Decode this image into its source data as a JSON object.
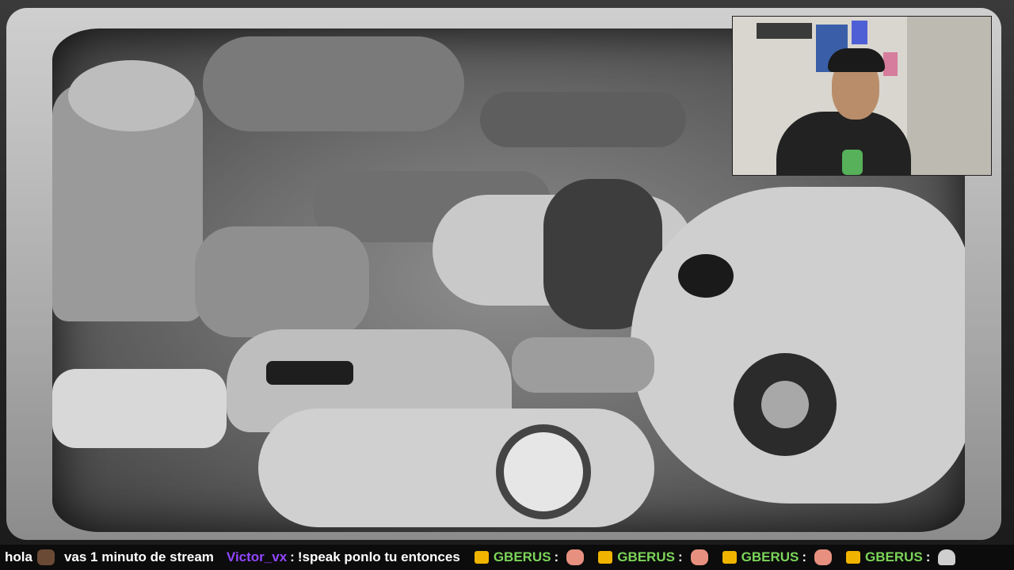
{
  "chat": {
    "messages": [
      {
        "text": "hola",
        "emote": "brown-bear-emote"
      },
      {
        "text": "vas 1 minuto de stream"
      },
      {
        "user": "Victor_vx",
        "sep": ":",
        "text": "!speak ponlo tu entonces"
      },
      {
        "user": "GBERUS",
        "sep": ":",
        "badge": "crown-badge-icon",
        "emote": "pink-foot-emote"
      },
      {
        "user": "GBERUS",
        "sep": ":",
        "badge": "crown-badge-icon",
        "emote": "pink-foot-emote"
      },
      {
        "user": "GBERUS",
        "sep": ":",
        "badge": "crown-badge-icon",
        "emote": "pink-foot-emote"
      },
      {
        "user": "GBERUS",
        "sep": ":",
        "badge": "crown-badge-icon",
        "emote": "ghost-emote"
      }
    ],
    "colors": {
      "purple": "#9147ff",
      "green": "#7cd45a",
      "badge": "#f0b400"
    }
  },
  "video": {
    "description": "monochrome-toy-cars-footage"
  },
  "webcam": {
    "description": "streamer-webcam"
  }
}
